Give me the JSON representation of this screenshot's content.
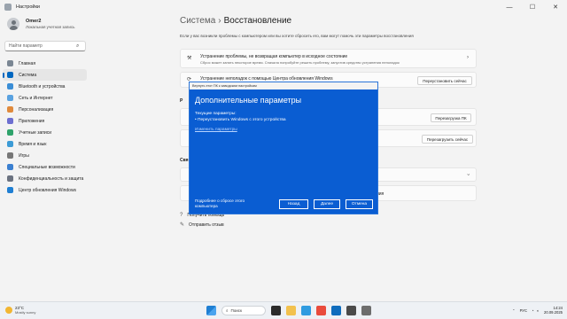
{
  "window": {
    "title": "Настройки",
    "controls": [
      "—",
      "☐",
      "✕"
    ]
  },
  "sidebar": {
    "user_name": "Omer2",
    "user_type": "Локальная учетная запись",
    "search_placeholder": "Найти параметр",
    "items": [
      {
        "label": "Главная",
        "color": "#7b8794"
      },
      {
        "label": "Система",
        "color": "#0067c0",
        "active": true
      },
      {
        "label": "Bluetooth и устройства",
        "color": "#3b8ed6"
      },
      {
        "label": "Сеть и Интернет",
        "color": "#5aa2e0"
      },
      {
        "label": "Персонализация",
        "color": "#e08a3c"
      },
      {
        "label": "Приложения",
        "color": "#6d6fd0"
      },
      {
        "label": "Учетные записи",
        "color": "#2fa36b"
      },
      {
        "label": "Время и язык",
        "color": "#3c9bd6"
      },
      {
        "label": "Игры",
        "color": "#777777"
      },
      {
        "label": "Специальные возможности",
        "color": "#3b7fd0"
      },
      {
        "label": "Конфиденциальность и защита",
        "color": "#6b7280"
      },
      {
        "label": "Центр обновления Windows",
        "color": "#1f7fd3"
      }
    ]
  },
  "breadcrumb": {
    "parent": "Система",
    "sep": "›",
    "current": "Восстановление"
  },
  "description": "Если у вас возникли проблемы с компьютером или вы хотите сбросить его, вам могут помочь эти параметры восстановления",
  "cards": {
    "fix": {
      "title": "Устранение проблемы, не возвращая компьютер в исходное состояние",
      "subtitle": "Сброс может занять некоторое время. Сначала попробуйте решить проблему, запустив средство устранения неполадок"
    },
    "troubleshooter": {
      "title": "Устранение неполадок с помощью Центра обновления Windows",
      "button": "Переустановить сейчас"
    },
    "reset_button": "Перезагрузка ПК",
    "advanced_button": "Перезагрузить сейчас",
    "section_r": "Р",
    "section_s": "Свя",
    "obscured_row_text": "ния"
  },
  "links": {
    "help": "Получить помощь",
    "feedback": "Отправить отзыв"
  },
  "dialog": {
    "topbar": "Вернуть этот ПК к заводским настройкам",
    "title": "Дополнительные параметры",
    "current_label": "Текущие параметры:",
    "bullet": "• Переустановить Windows с этого устройства",
    "change_link": "Изменить параметры",
    "help_text": "Подробнее о сбросе этого компьютера",
    "back": "Назад",
    "next": "Далее",
    "cancel": "Отмена"
  },
  "taskbar": {
    "temp": "23°C",
    "weather": "Mostly sunny",
    "search": "Поиск",
    "lang": "РУС",
    "time": "14:24",
    "date": "20.09.2025"
  }
}
